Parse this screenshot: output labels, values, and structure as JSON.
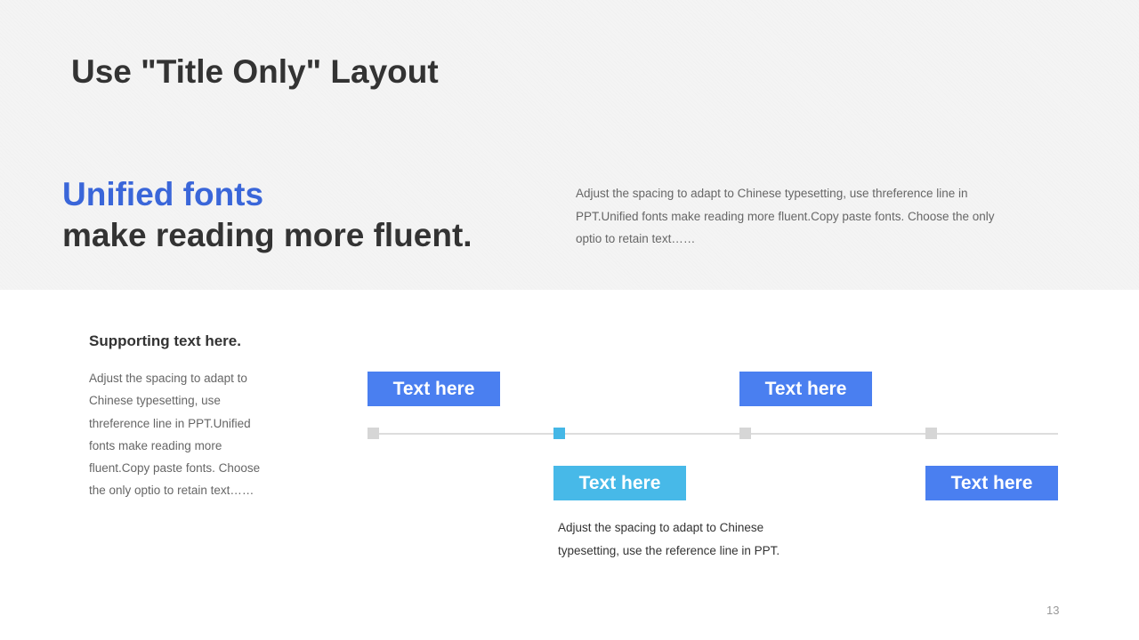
{
  "slide": {
    "title": "Use \"Title Only\" Layout",
    "page_number": "13"
  },
  "headline": {
    "accent": "Unified fonts",
    "rest": "make reading more fluent."
  },
  "intro": {
    "text": "Adjust the spacing to adapt to Chinese typesetting, use threference line in PPT.Unified fonts make reading more fluent.Copy paste fonts. Choose the only optio to retain text……"
  },
  "supporting": {
    "title": "Supporting text here.",
    "body": "Adjust the spacing to adapt to Chinese typesetting, use threference line in PPT.Unified fonts make reading more fluent.Copy paste fonts. Choose the only optio to retain text……"
  },
  "timeline": {
    "labels": [
      "Text here",
      "Text here",
      "Text here",
      "Text here"
    ],
    "active_index": 1,
    "detail_text": "Adjust the spacing to adapt to Chinese typesetting, use the reference line in PPT."
  },
  "colors": {
    "accent_blue": "#3a66d9",
    "box_blue": "#4a7ff0",
    "box_cyan": "#47b9e8",
    "marker_grey": "#d6d6d6",
    "marker_active": "#45b7e6"
  }
}
